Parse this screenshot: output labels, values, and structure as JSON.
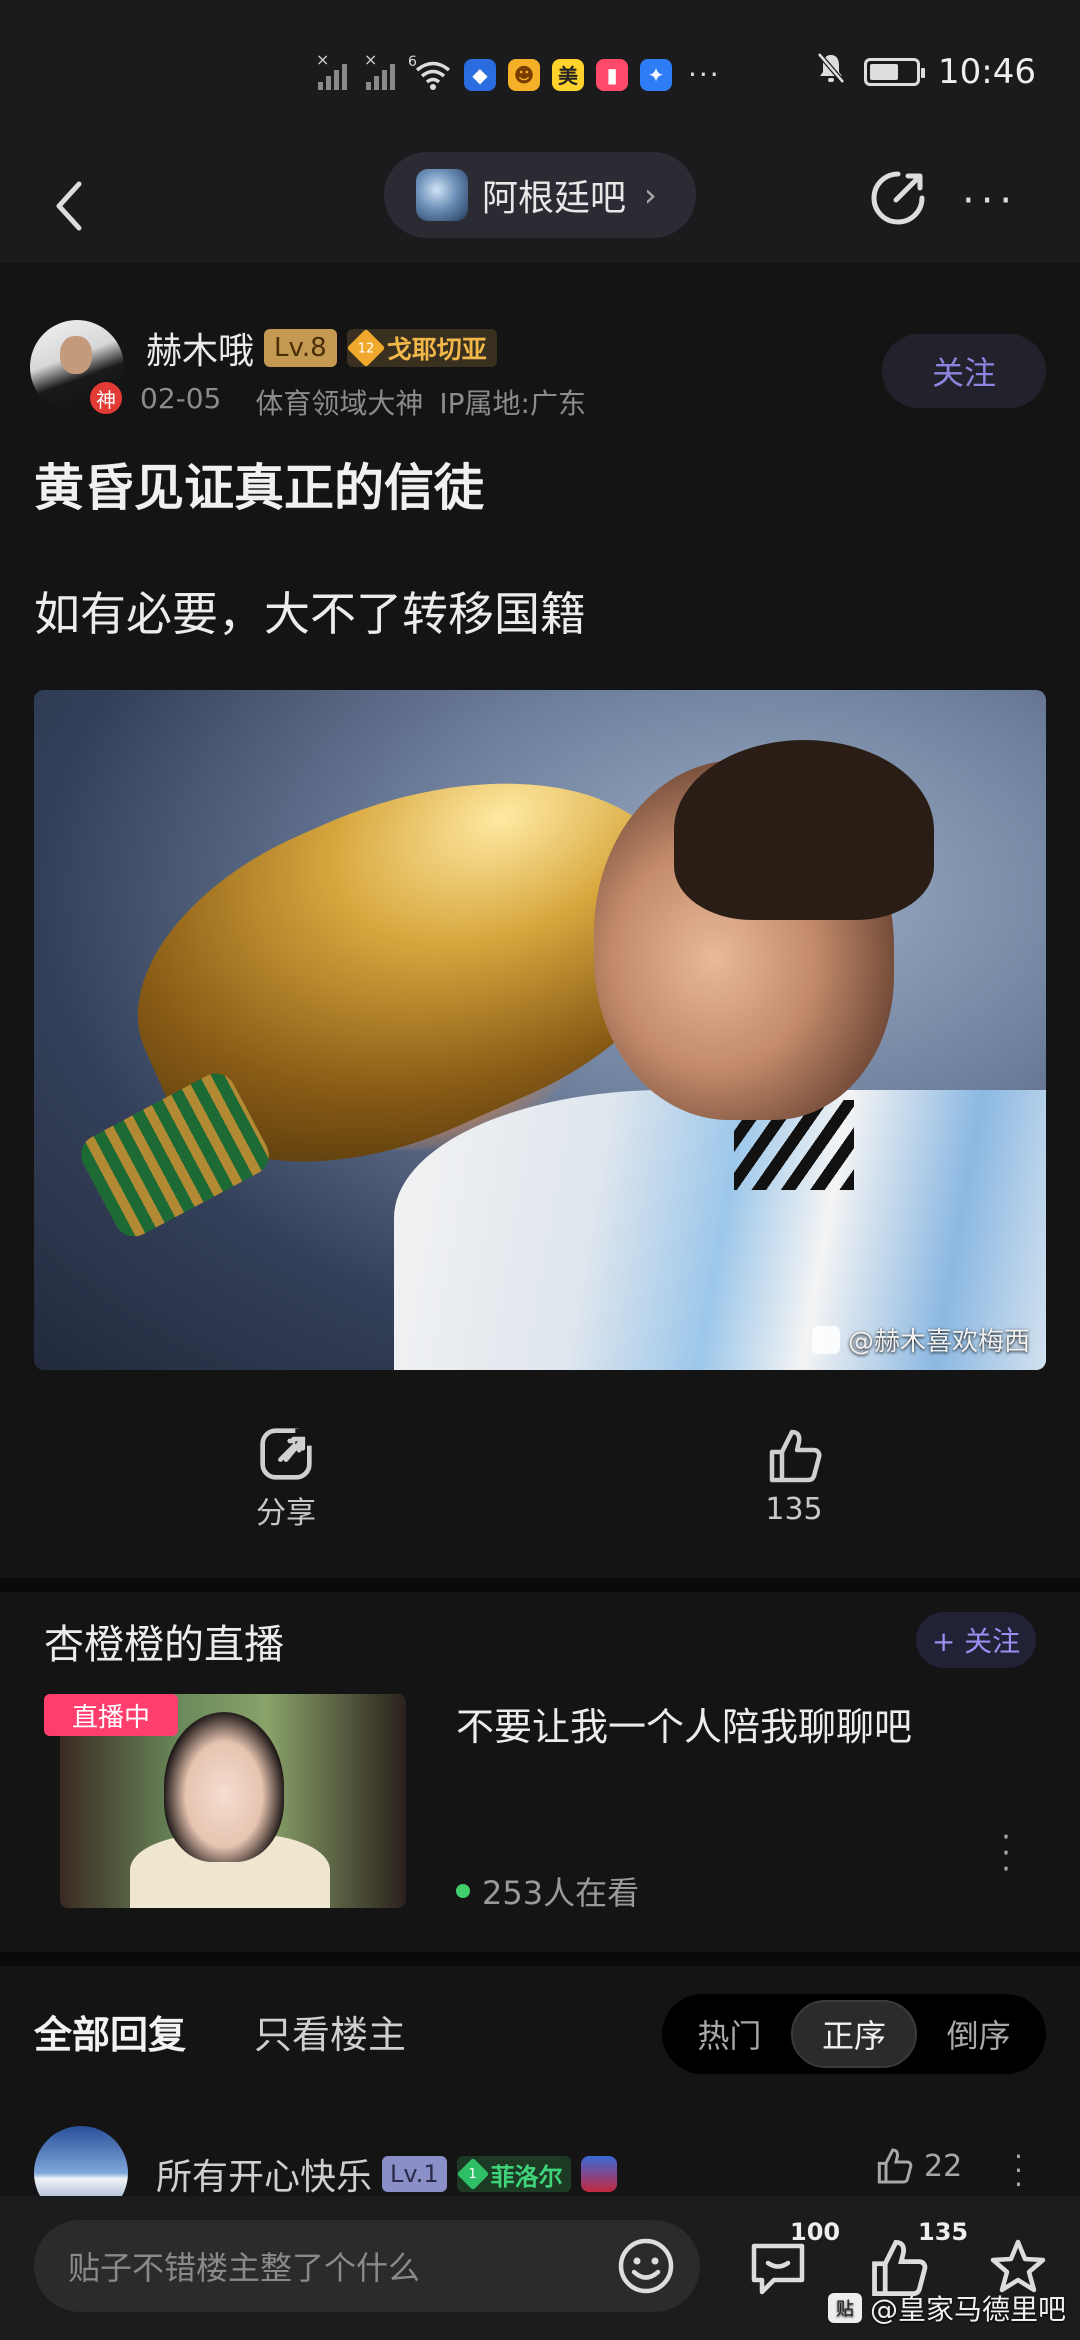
{
  "status_bar": {
    "time": "10:46",
    "network_label": "6",
    "app_icons": [
      {
        "name": "shield-app-icon",
        "color": "#2b6de0",
        "glyph": "♦"
      },
      {
        "name": "game-app-icon",
        "color": "#f4b128",
        "glyph": "☻"
      },
      {
        "name": "meituan-app-icon",
        "color": "#ffd22b",
        "glyph": "美"
      },
      {
        "name": "book-app-icon",
        "color": "#ff4a6b",
        "glyph": "▮"
      },
      {
        "name": "bulb-app-icon",
        "color": "#2e7cf6",
        "glyph": "✦"
      }
    ]
  },
  "nav": {
    "forum_name": "阿根廷吧"
  },
  "post": {
    "author": "赫木哦",
    "avatar_badge": "神",
    "level": "Lv.8",
    "fan_level": "12",
    "fan_title": "戈耶切亚",
    "date": "02-05",
    "title_tag": "体育领域大神",
    "ip_location": "IP属地:广东",
    "follow_label": "关注",
    "title": "黄昏见证真正的信徒",
    "body": "如有必要，大不了转移国籍",
    "image_watermark": "@赫木喜欢梅西",
    "share_label": "分享",
    "like_count": "135"
  },
  "live": {
    "section_title": "杏橙橙的直播",
    "follow_label": "+ 关注",
    "badge": "直播中",
    "headline": "不要让我一个人陪我聊聊吧",
    "viewers": "253人在看"
  },
  "replies": {
    "tab_all": "全部回复",
    "tab_op": "只看楼主",
    "sort_options": [
      "热门",
      "正序",
      "倒序"
    ],
    "active_sort": "正序",
    "first_reply": {
      "username": "所有开心快乐",
      "level": "Lv.1",
      "fan_level": "1",
      "fan_title": "菲洛尔",
      "like_count": "22"
    }
  },
  "bottom_bar": {
    "input_placeholder": "贴子不错楼主整了个什么",
    "comment_count": "100",
    "like_count": "135",
    "watermark": "@皇家马德里吧",
    "watermark_icon": "贴"
  },
  "colors": {
    "accent": "#8f83e0",
    "live_badge": "#ff3e6e",
    "online_dot": "#3fce6b",
    "level_gold": "#c49a52"
  }
}
